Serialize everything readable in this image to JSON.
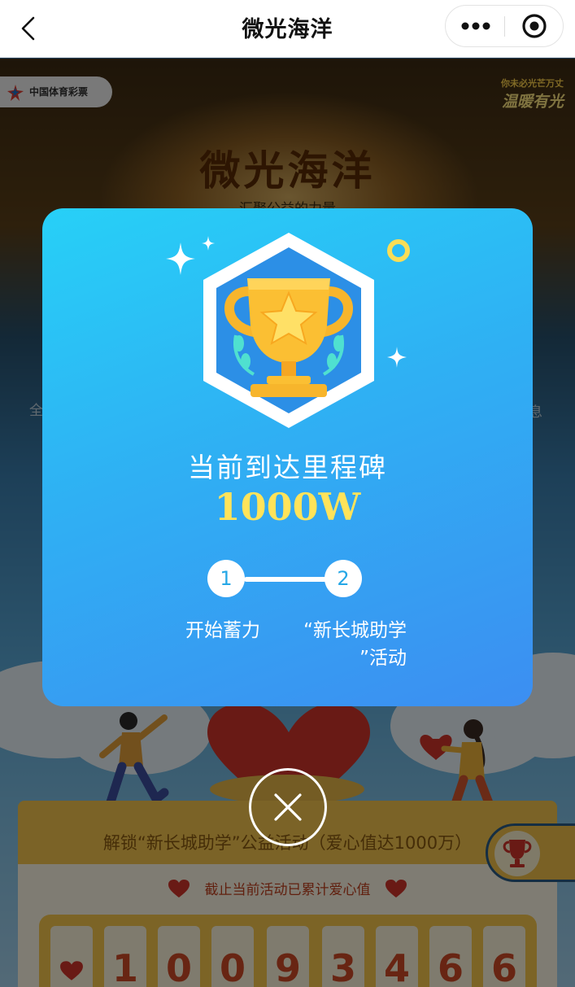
{
  "nav": {
    "title": "微光海洋",
    "back_icon": "chevron-left-icon",
    "more_icon": "more-dots-icon",
    "target_icon": "target-icon"
  },
  "banner": {
    "sponsor": "中国体育彩票",
    "slogan_line1": "你未必光芒万丈",
    "slogan_line2": "温暖有光",
    "title": "微光海洋",
    "subtitle": "汇聚公益的力量"
  },
  "modal": {
    "heading": "当前到达里程碑",
    "value": "1000W",
    "steps": [
      {
        "number": "1",
        "label": "开始蓄力"
      },
      {
        "number": "2",
        "label_line1": "“新长城助学",
        "label_line2": "”活动"
      }
    ],
    "badge_icon": "trophy-icon"
  },
  "close_icon": "close-icon",
  "background": {
    "stage_text": "解锁“新长城助学”公益活动（爱心值达1000万）",
    "counter_label": "截止当前活动已累计爱心值",
    "counter_digits": [
      "1",
      "0",
      "0",
      "9",
      "3",
      "4",
      "6",
      "6"
    ],
    "edge_left": "全",
    "edge_right": "息"
  },
  "colors": {
    "modal_gradient_start": "#27d0f7",
    "modal_gradient_end": "#3c8ef2",
    "milestone_value": "#ffe35a",
    "counter_digit": "#d04a26",
    "heart_red": "#d3352b"
  }
}
